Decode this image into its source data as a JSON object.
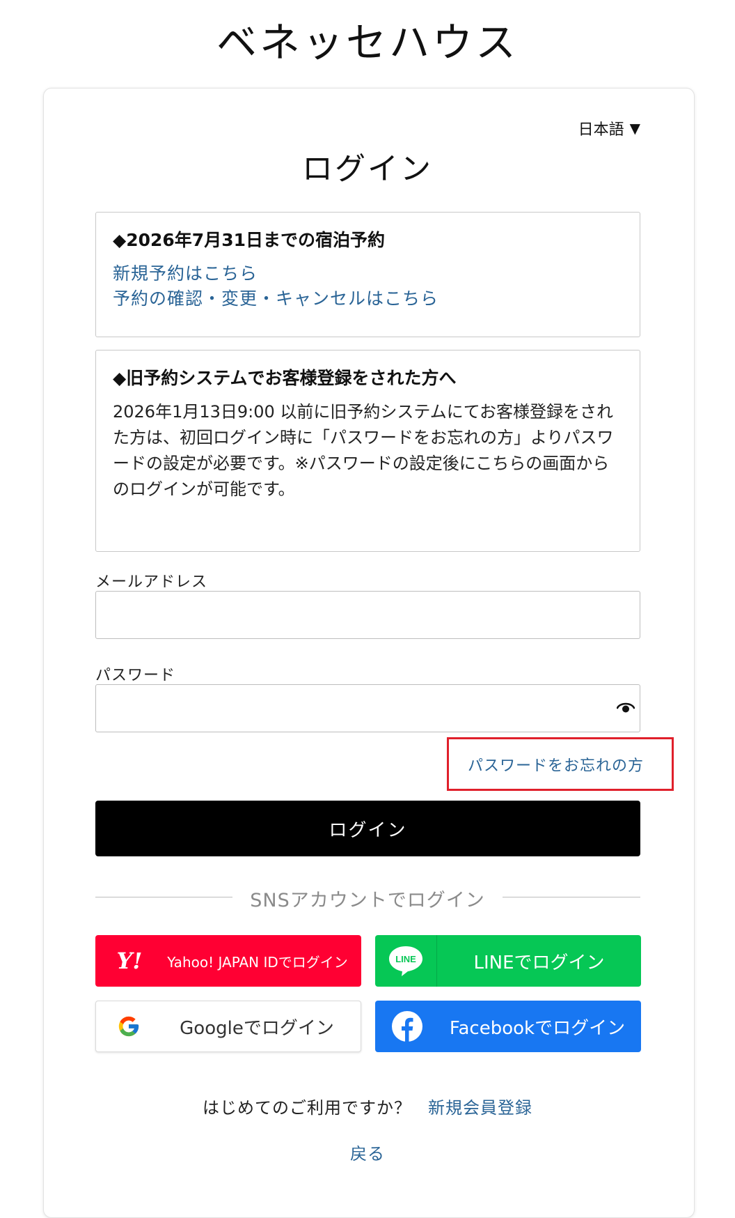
{
  "brand": "ベネッセハウス",
  "language": {
    "label": "日本語",
    "caret": "▼"
  },
  "page_title": "ログイン",
  "notice_reservation": {
    "heading": "◆2026年7月31日までの宿泊予約",
    "link_new": "新規予約はこちら",
    "link_manage": "予約の確認・変更・キャンセルはこちら"
  },
  "notice_legacy": {
    "heading": "◆旧予約システムでお客様登録をされた方へ",
    "body": "2026年1月13日9:00 以前に旧予約システムにてお客様登録をされた方は、初回ログイン時に「パスワードをお忘れの方」よりパスワードの設定が必要です。※パスワードの設定後にこちらの画面からのログインが可能です。"
  },
  "form": {
    "email_label": "メールアドレス",
    "email_value": "",
    "password_label": "パスワード",
    "password_value": "",
    "forgot_password": "パスワードをお忘れの方",
    "login_button": "ログイン"
  },
  "sns": {
    "divider_label": "SNSアカウントでログイン",
    "yahoo": {
      "logo": "Y!",
      "label": "Yahoo! JAPAN IDでログイン",
      "color": "#ff0033"
    },
    "line": {
      "logo": "LINE",
      "label": "LINEでログイン",
      "color": "#06c755"
    },
    "google": {
      "label": "Googleでログイン"
    },
    "facebook": {
      "label": "Facebookでログイン",
      "color": "#1877f2"
    }
  },
  "footer": {
    "first_time_text": "はじめてのご利用ですか？",
    "register_link": "新規会員登録",
    "back_link": "戻る"
  },
  "colors": {
    "link": "#2a6496",
    "highlight_border": "#e0202b"
  }
}
